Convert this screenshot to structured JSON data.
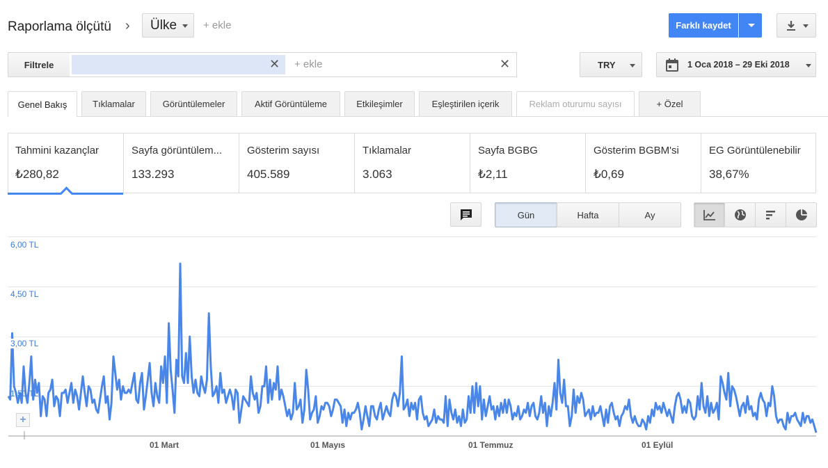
{
  "header": {
    "title": "Raporlama ölçütü",
    "dimension": "Ülke",
    "add_link": "+ ekle",
    "save_label": "Farklı kaydet"
  },
  "filter": {
    "label": "Filtrele",
    "add_placeholder": "+ ekle",
    "currency": "TRY",
    "date_range": "1 Oca 2018 – 29 Eki 2018"
  },
  "tabs": [
    {
      "label": "Genel Bakış"
    },
    {
      "label": "Tıklamalar"
    },
    {
      "label": "Görüntülemeler"
    },
    {
      "label": "Aktif Görüntüleme"
    },
    {
      "label": "Etkileşimler"
    },
    {
      "label": "Eşleştirilen içerik"
    },
    {
      "label": "Reklam oturumu sayısı"
    },
    {
      "label": "+ Özel"
    }
  ],
  "metrics": [
    {
      "label": "Tahmini kazançlar",
      "value": "₺280,82"
    },
    {
      "label": "Sayfa görüntülem...",
      "value": "133.293"
    },
    {
      "label": "Gösterim sayısı",
      "value": "405.589"
    },
    {
      "label": "Tıklamalar",
      "value": "3.063"
    },
    {
      "label": "Sayfa BGBG",
      "value": "₺2,11"
    },
    {
      "label": "Gösterim BGBM'si",
      "value": "₺0,69"
    },
    {
      "label": "EG Görüntülenebilir",
      "value": "38,67%"
    }
  ],
  "granularity": {
    "day": "Gün",
    "week": "Hafta",
    "month": "Ay",
    "selected": "Gün"
  },
  "icons": {
    "breadcrumb": "chevron-right-icon",
    "calendar": "calendar-icon",
    "download": "download-icon",
    "comment": "comment-icon",
    "views": [
      "line-chart-icon",
      "globe-icon",
      "bar-chart-icon",
      "pie-chart-icon"
    ]
  },
  "colors": {
    "accent": "#4285f4",
    "line": "#4a86e8",
    "axis_label": "#3e7bd9"
  },
  "chart_data": {
    "type": "line",
    "ytick_labels": [
      "6,00 TL",
      "4,50 TL",
      "3,00 TL",
      "1,50 TL"
    ],
    "xtick_labels": [
      "01 Mart",
      "01 Mayıs",
      "01 Temmuz",
      "01 Eylül"
    ],
    "ylim": [
      0,
      6
    ],
    "series": [
      {
        "values": [
          1.2,
          1.1,
          3.1,
          1.5,
          1.3,
          1.0,
          1.3,
          1.0,
          2.1,
          1.3,
          1.0,
          1.6,
          2.4,
          1.1,
          1.7,
          1.3,
          1.6,
          0.6,
          1.2,
          1.1,
          0.6,
          1.3,
          1.4,
          1.7,
          0.9,
          1.2,
          1.1,
          0.6,
          1.3,
          1.3,
          1.4,
          1.0,
          1.3,
          1.6,
          1.0,
          1.4,
          1.2,
          0.8,
          1.3,
          1.8,
          1.3,
          0.9,
          1.5,
          1.4,
          1.0,
          1.1,
          0.8,
          0.7,
          1.1,
          1.5,
          1.8,
          1.0,
          1.2,
          0.5,
          1.0,
          2.4,
          1.9,
          1.4,
          1.7,
          1.1,
          1.5,
          1.3,
          1.3,
          1.4,
          1.3,
          1.6,
          1.9,
          1.1,
          1.0,
          1.6,
          1.9,
          0.8,
          1.2,
          1.7,
          2.2,
          1.3,
          0.9,
          1.6,
          1.2,
          1.0,
          2.1,
          1.6,
          2.4,
          1.0,
          3.4,
          2.0,
          1.4,
          0.7,
          2.3,
          1.8,
          5.2,
          1.8,
          1.6,
          2.5,
          1.6,
          3.0,
          1.8,
          1.3,
          1.7,
          1.3,
          1.2,
          1.8,
          1.5,
          1.3,
          1.7,
          3.7,
          2.1,
          1.2,
          1.3,
          1.5,
          1.0,
          1.9,
          1.3,
          1.4,
          1.0,
          1.2,
          1.4,
          1.2,
          0.8,
          1.4,
          1.3,
          0.4,
          0.8,
          1.2,
          1.1,
          1.0,
          0.9,
          1.8,
          1.3,
          1.1,
          1.3,
          0.7,
          0.9,
          1.5,
          1.5,
          2.1,
          1.0,
          1.7,
          1.1,
          1.6,
          1.4,
          2.1,
          1.1,
          1.4,
          1.2,
          0.9,
          0.6,
          0.8,
          0.5,
          0.7,
          1.6,
          0.8,
          0.9,
          1.1,
          0.4,
          0.8,
          2.0,
          1.4,
          0.5,
          0.7,
          0.8,
          1.2,
          0.4,
          0.6,
          0.9,
          0.8,
          1.0,
          1.0,
          0.9,
          0.6,
          0.8,
          1.1,
          1.1,
          1.0,
          0.9,
          0.4,
          0.8,
          0.3,
          0.7,
          0.5,
          0.7,
          0.7,
          0.8,
          1.0,
          0.7,
          0.2,
          0.5,
          0.9,
          0.6,
          0.3,
          0.9,
          0.9,
          0.6,
          0.5,
          0.8,
          1.0,
          0.5,
          0.7,
          0.9,
          0.7,
          0.6,
          1.1,
          1.3,
          1.2,
          0.9,
          1.3,
          2.4,
          0.8,
          0.9,
          1.1,
          0.6,
          1.0,
          0.8,
          1.0,
          0.5,
          1.1,
          1.2,
          0.7,
          0.5,
          0.6,
          0.3,
          0.4,
          0.5,
          0.8,
          0.4,
          0.6,
          0.5,
          0.5,
          0.4,
          1.2,
          0.3,
          1.1,
          0.7,
          0.5,
          0.8,
          0.4,
          0.6,
          0.3,
          0.8,
          0.4,
          0.5,
          1.2,
          0.7,
          1.5,
          0.7,
          1.6,
          0.9,
          1.5,
          0.5,
          1.1,
          0.6,
          0.9,
          1.2,
          0.8,
          0.9,
          0.5,
          0.9,
          0.6,
          1.0,
          0.7,
          1.1,
          0.7,
          1.1,
          0.9,
          0.5,
          0.7,
          0.6,
          0.9,
          0.5,
          0.6,
          0.8,
          0.7,
          1.0,
          0.6,
          0.9,
          1.0,
          0.6,
          0.5,
          0.7,
          1.2,
          0.7,
          1.0,
          0.3,
          0.9,
          0.6,
          1.0,
          1.6,
          0.8,
          2.3,
          1.3,
          1.0,
          1.7,
          0.9,
          0.9,
          0.3,
          0.6,
          1.4,
          0.7,
          1.2,
          1.0,
          1.3,
          1.1,
          0.6,
          0.7,
          0.8,
          0.5,
          0.9,
          0.6,
          0.7,
          0.7,
          0.9,
          0.6,
          0.3,
          0.8,
          0.4,
          0.9,
          1.0,
          0.7,
          0.5,
          0.6,
          0.3,
          0.6,
          0.7,
          0.9,
          0.8,
          1.1,
          0.6,
          0.4,
          0.6,
          0.4,
          0.3,
          0.3,
          0.5,
          0.4,
          0.2,
          0.6,
          0.4,
          0.8,
          0.6,
          1.0,
          0.8,
          0.9,
          0.7,
          1.0,
          0.8,
          0.6,
          0.8,
          0.6,
          0.4,
          0.9,
          1.2,
          1.3,
          1.1,
          0.7,
          0.9,
          0.7,
          1.1,
          1.0,
          0.6,
          0.5,
          0.6,
          1.2,
          0.8,
          1.6,
          0.9,
          0.7,
          1.2,
          0.6,
          1.0,
          0.7,
          0.8,
          1.0,
          0.5,
          1.8,
          1.6,
          1.3,
          1.1,
          1.9,
          0.9,
          1.5,
          1.4,
          1.2,
          0.9,
          0.6,
          0.9,
          1.0,
          0.7,
          1.2,
          0.8,
          0.9,
          0.6,
          0.7,
          0.5,
          1.1,
          1.3,
          1.1,
          1.0,
          0.6,
          1.0,
          0.9,
          1.5,
          1.2,
          0.6,
          0.4,
          0.5,
          0.5,
          0.3,
          0.2,
          0.7,
          0.4,
          0.6,
          0.6,
          0.7,
          0.5,
          0.4,
          0.3,
          0.7,
          0.4,
          0.6,
          0.6,
          0.4,
          0.5,
          0.3,
          0.1
        ]
      }
    ]
  }
}
